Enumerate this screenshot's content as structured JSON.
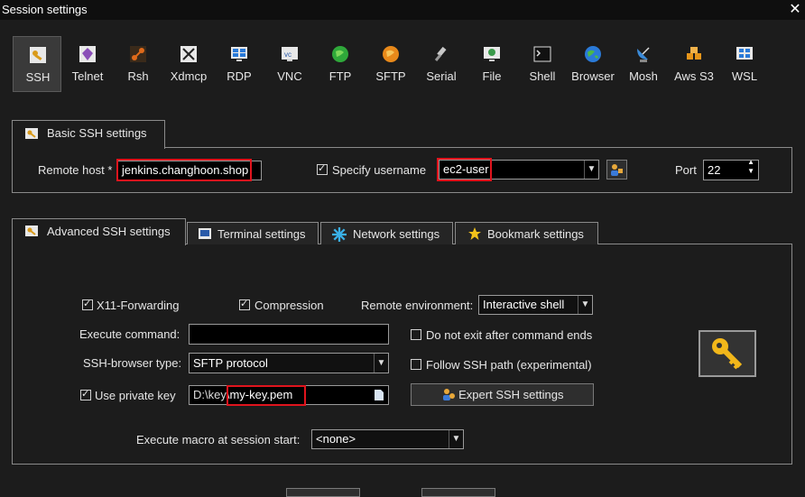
{
  "window": {
    "title": "Session settings",
    "close_icon": "close-icon"
  },
  "session_types": [
    {
      "label": "SSH",
      "icon": "key-wrench-icon"
    },
    {
      "label": "Telnet",
      "icon": "purple-gem-icon"
    },
    {
      "label": "Rsh",
      "icon": "network-icon"
    },
    {
      "label": "Xdmcp",
      "icon": "x-window-icon"
    },
    {
      "label": "RDP",
      "icon": "windows-desktop-icon"
    },
    {
      "label": "VNC",
      "icon": "vnc-monitor-icon"
    },
    {
      "label": "FTP",
      "icon": "green-globe-icon"
    },
    {
      "label": "SFTP",
      "icon": "orange-globe-icon"
    },
    {
      "label": "Serial",
      "icon": "satellite-plug-icon"
    },
    {
      "label": "File",
      "icon": "file-monitor-icon"
    },
    {
      "label": "Shell",
      "icon": "shell-terminal-icon"
    },
    {
      "label": "Browser",
      "icon": "earth-globe-icon"
    },
    {
      "label": "Mosh",
      "icon": "satellite-dish-icon"
    },
    {
      "label": "Aws S3",
      "icon": "aws-cubes-icon"
    },
    {
      "label": "WSL",
      "icon": "windows-logo-icon"
    }
  ],
  "basic": {
    "tab_label": "Basic SSH settings",
    "remote_host_label": "Remote host *",
    "remote_host_value": "jenkins.changhoon.shop",
    "specify_username_label": "Specify username",
    "specify_username_checked": true,
    "username_value": "ec2-user",
    "port_label": "Port",
    "port_value": "22"
  },
  "tabs": [
    {
      "label": "Advanced SSH settings",
      "icon": "wrench-icon",
      "active": true
    },
    {
      "label": "Terminal settings",
      "icon": "terminal-icon",
      "active": false
    },
    {
      "label": "Network settings",
      "icon": "network-star-icon",
      "active": false
    },
    {
      "label": "Bookmark settings",
      "icon": "star-icon",
      "active": false
    }
  ],
  "advanced": {
    "x11_label": "X11-Forwarding",
    "x11_checked": true,
    "compression_label": "Compression",
    "compression_checked": true,
    "remote_env_label": "Remote environment:",
    "remote_env_value": "Interactive shell",
    "execute_command_label": "Execute command:",
    "execute_command_value": "",
    "no_exit_label": "Do not exit after command ends",
    "no_exit_checked": false,
    "ssh_browser_label": "SSH-browser type:",
    "ssh_browser_value": "SFTP protocol",
    "follow_ssh_label": "Follow SSH path (experimental)",
    "follow_ssh_checked": false,
    "use_private_key_label": "Use private key",
    "use_private_key_checked": true,
    "private_key_prefix": "D:\\key\\",
    "private_key_file": "my-key.pem",
    "expert_button_label": "Expert SSH settings",
    "macro_label": "Execute macro at session start:",
    "macro_value": "<none>"
  }
}
